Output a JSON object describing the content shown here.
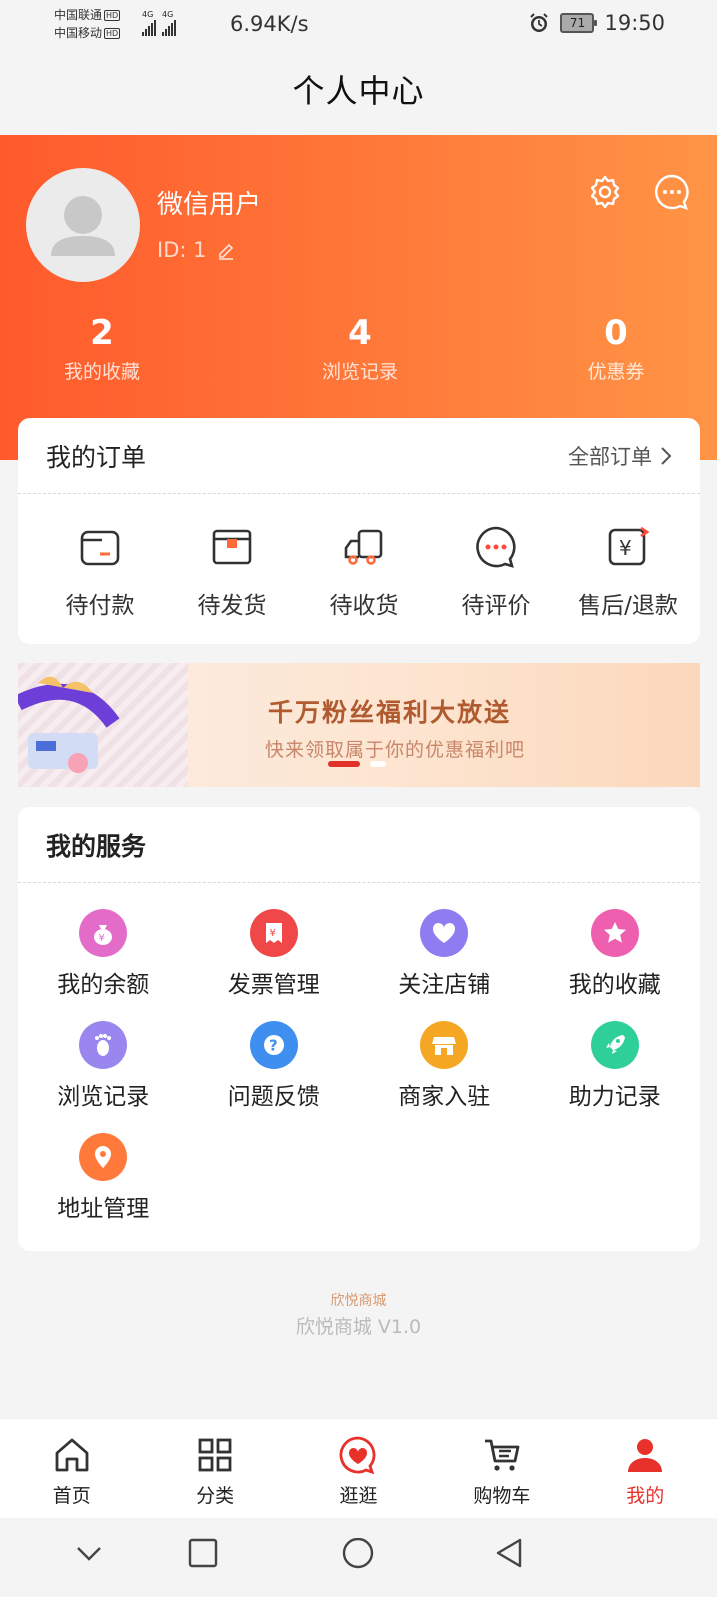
{
  "status_bar": {
    "carrier1": "中国联通",
    "carrier2": "中国移动",
    "hd": "HD",
    "net1": "4G",
    "net2": "4G",
    "speed": "6.94K/s",
    "battery": "71",
    "time": "19:50"
  },
  "page_title": "个人中心",
  "profile": {
    "name": "微信用户",
    "id_text": "ID:  1",
    "stats": [
      {
        "value": "2",
        "label": "我的收藏"
      },
      {
        "value": "4",
        "label": "浏览记录"
      },
      {
        "value": "0",
        "label": "优惠券"
      }
    ]
  },
  "orders": {
    "title": "我的订单",
    "all_label": "全部订单",
    "items": [
      {
        "label": "待付款",
        "icon": "wallet-icon"
      },
      {
        "label": "待发货",
        "icon": "package-icon"
      },
      {
        "label": "待收货",
        "icon": "truck-icon"
      },
      {
        "label": "待评价",
        "icon": "chat-icon"
      },
      {
        "label": "售后/退款",
        "icon": "refund-icon"
      }
    ]
  },
  "banner": {
    "title": "千万粉丝福利大放送",
    "subtitle": "快来领取属于你的优惠福利吧"
  },
  "services": {
    "title": "我的服务",
    "items": [
      {
        "label": "我的余额",
        "icon": "money-bag-icon",
        "color": "#e46cc9"
      },
      {
        "label": "发票管理",
        "icon": "invoice-icon",
        "color": "#f04848"
      },
      {
        "label": "关注店铺",
        "icon": "heart-icon",
        "color": "#8f7cf0"
      },
      {
        "label": "我的收藏",
        "icon": "star-icon",
        "color": "#ee5fb0"
      },
      {
        "label": "浏览记录",
        "icon": "footprint-icon",
        "color": "#9a86ef"
      },
      {
        "label": "问题反馈",
        "icon": "question-icon",
        "color": "#3e8ff0"
      },
      {
        "label": "商家入驻",
        "icon": "shop-icon",
        "color": "#f5a623"
      },
      {
        "label": "助力记录",
        "icon": "rocket-icon",
        "color": "#2fcf9a"
      },
      {
        "label": "地址管理",
        "icon": "location-icon",
        "color": "#ff7a3a"
      }
    ]
  },
  "footer": {
    "brand": "欣悦商城",
    "version": "欣悦商城 V1.0"
  },
  "tabbar": {
    "items": [
      {
        "label": "首页",
        "icon": "home-icon"
      },
      {
        "label": "分类",
        "icon": "grid-icon"
      },
      {
        "label": "逛逛",
        "icon": "heart-bubble-icon"
      },
      {
        "label": "购物车",
        "icon": "cart-icon"
      },
      {
        "label": "我的",
        "icon": "person-icon"
      }
    ],
    "active_index": 4,
    "active_color": "#e8312b"
  }
}
